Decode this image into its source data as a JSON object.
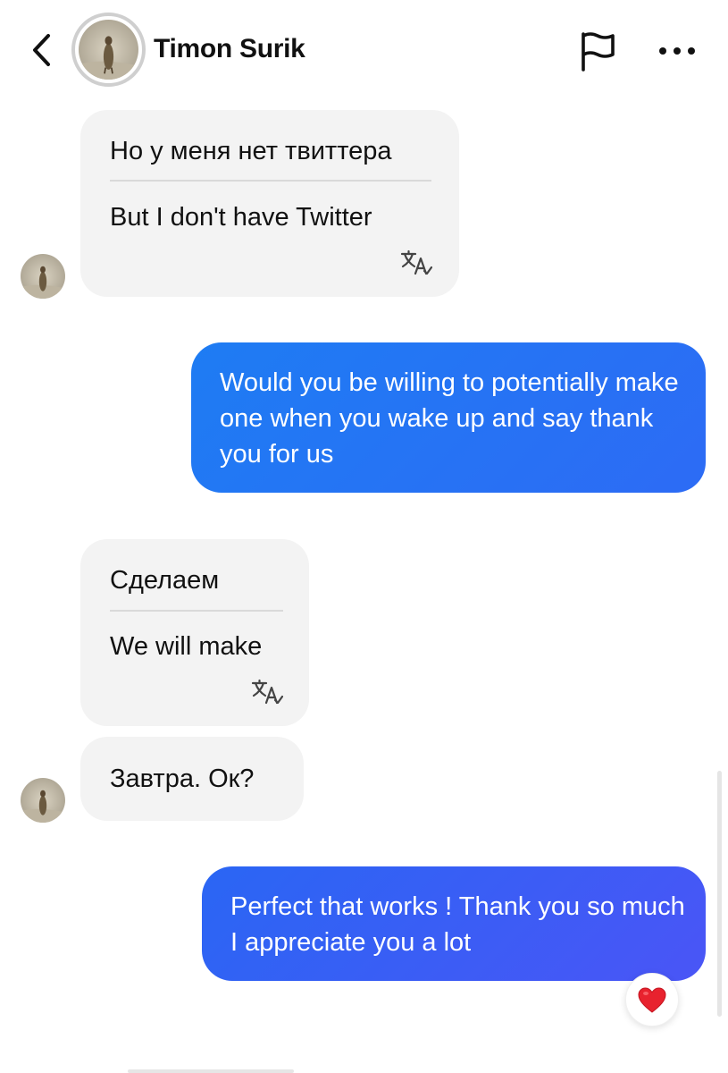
{
  "header": {
    "contact_name": "Timon Surik"
  },
  "messages": [
    {
      "direction": "incoming",
      "original": "Но у меня нет твиттера",
      "translation": "But I don't have Twitter",
      "has_translate_icon": true
    },
    {
      "direction": "outgoing",
      "text": "Would you be willing to potentially make one when you wake up and say thank you for us"
    },
    {
      "direction": "incoming",
      "original": "Сделаем",
      "translation": "We will make",
      "has_translate_icon": true
    },
    {
      "direction": "incoming",
      "text": "Завтра. Ок?"
    },
    {
      "direction": "outgoing",
      "text": "Perfect that works ! Thank you so much I appreciate you a lot",
      "reaction": "❤️"
    }
  ],
  "colors": {
    "incoming_bubble": "#f3f3f3",
    "outgoing_gradient_start": "#1d7bf2",
    "outgoing_gradient_end": "#4a55f7",
    "reaction_heart": "#e8222e"
  },
  "icons": {
    "back": "chevron-left-icon",
    "report": "flag-icon",
    "more": "more-horizontal-icon",
    "translate": "translate-icon"
  }
}
